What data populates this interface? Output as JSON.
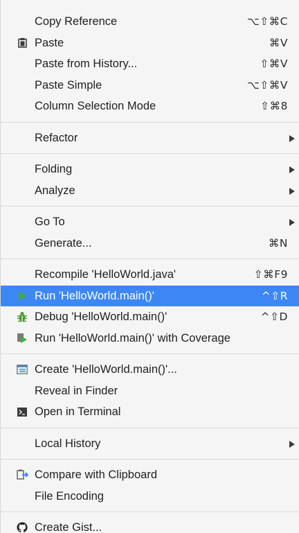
{
  "menu": {
    "copy_reference": {
      "label": "Copy Reference",
      "shortcut": "⌥⇧⌘C"
    },
    "paste": {
      "label": "Paste",
      "shortcut": "⌘V",
      "icon": "clipboard-icon"
    },
    "paste_history": {
      "label": "Paste from History...",
      "shortcut": "⇧⌘V"
    },
    "paste_simple": {
      "label": "Paste Simple",
      "shortcut": "⌥⇧⌘V"
    },
    "column_selection": {
      "label": "Column Selection Mode",
      "shortcut": "⇧⌘8"
    },
    "refactor": {
      "label": "Refactor"
    },
    "folding": {
      "label": "Folding"
    },
    "analyze": {
      "label": "Analyze"
    },
    "go_to": {
      "label": "Go To"
    },
    "generate": {
      "label": "Generate...",
      "shortcut": "⌘N"
    },
    "recompile": {
      "label": "Recompile 'HelloWorld.java'",
      "shortcut": "⇧⌘F9"
    },
    "run": {
      "label": "Run 'HelloWorld.main()'",
      "shortcut": "^⇧R",
      "icon": "run-icon"
    },
    "debug": {
      "label": "Debug 'HelloWorld.main()'",
      "shortcut": "^⇧D",
      "icon": "bug-icon"
    },
    "run_coverage": {
      "label": "Run 'HelloWorld.main()' with Coverage",
      "icon": "coverage-icon"
    },
    "create_config": {
      "label": "Create 'HelloWorld.main()'...",
      "icon": "run-config-icon"
    },
    "reveal_finder": {
      "label": "Reveal in Finder"
    },
    "open_terminal": {
      "label": "Open in Terminal",
      "icon": "terminal-icon"
    },
    "local_history": {
      "label": "Local History"
    },
    "compare_clipboard": {
      "label": "Compare with Clipboard",
      "icon": "compare-icon"
    },
    "file_encoding": {
      "label": "File Encoding"
    },
    "create_gist": {
      "label": "Create Gist...",
      "icon": "github-icon"
    }
  },
  "colors": {
    "selection": "#3d87f5",
    "run_green": "#3cae3c",
    "background": "#f5f5f5"
  }
}
